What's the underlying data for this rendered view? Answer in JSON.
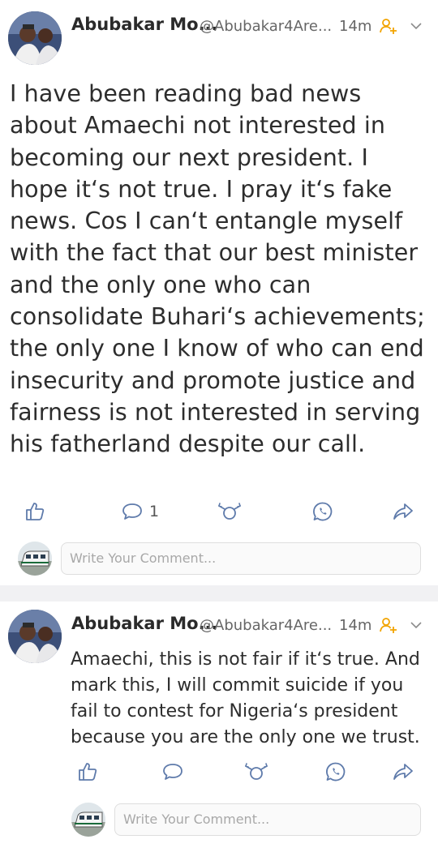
{
  "posts": [
    {
      "author": "Abubakar Mo...",
      "handle": "@Abubakar4Are...",
      "time": "14m",
      "text": "I have been reading bad news about Amaechi not interested in becoming our next president. I hope it‘s not true. I pray it‘s fake news. Cos I can‘t entangle myself with the fact that our best minister and the only one who can consolidate Buhari‘s achievements; the only one I know of who can end insecurity and promote justice and fairness is not interested in serving his fatherland despite our call.",
      "comment_count": "1",
      "comment_placeholder": "Write Your Comment..."
    },
    {
      "author": "Abubakar Mo...",
      "handle": "@Abubakar4Are...",
      "time": "14m",
      "text": "Amaechi, this is not fair if it‘s true. And mark this, I will commit suicide if you fail to contest for Nigeria‘s president because you are the only one we trust.",
      "comment_count": "",
      "comment_placeholder": "Write Your Comment..."
    }
  ],
  "icons": {
    "like": "thumbs-up-icon",
    "comment": "comment-bubble-icon",
    "repost": "repost-icon",
    "whatsapp": "whatsapp-icon",
    "share": "share-arrow-icon",
    "follow": "add-follow-icon",
    "more": "chevron-down-icon"
  },
  "colors": {
    "icon_blue": "#5f7bab",
    "follow_orange": "#f2a400",
    "separator": "#f1f1f3"
  }
}
